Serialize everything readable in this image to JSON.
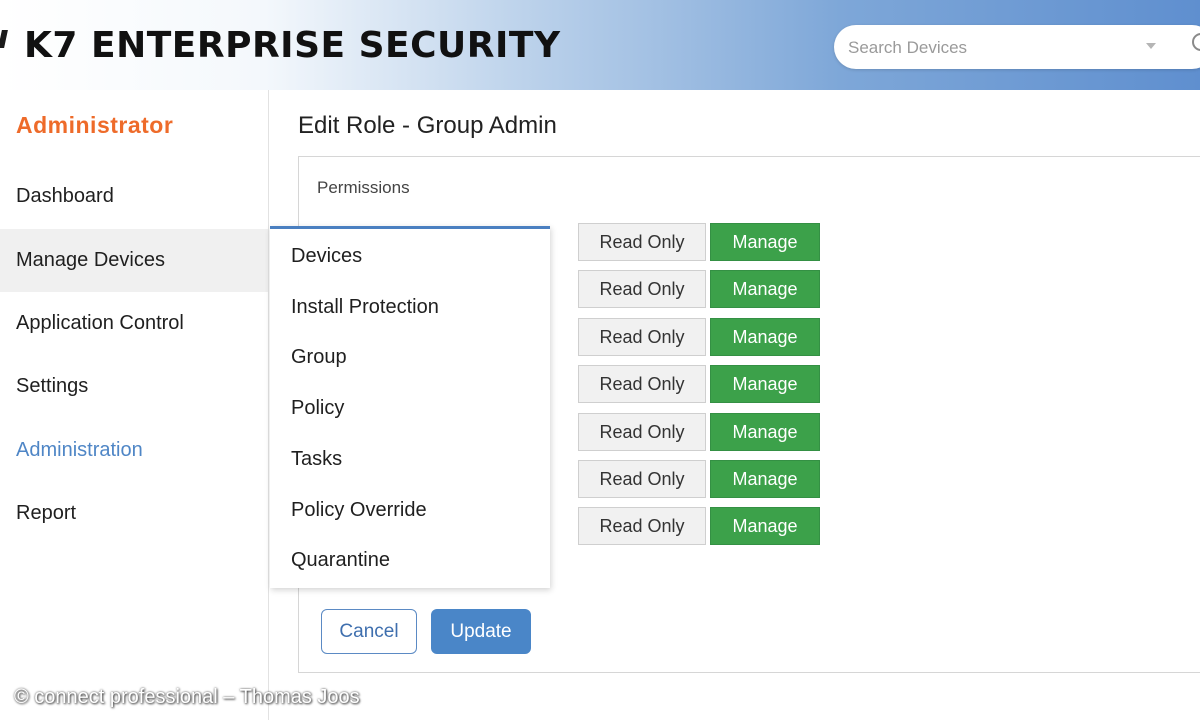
{
  "header": {
    "logo_text": "K7 ENTERPRISE SECURITY",
    "search": {
      "placeholder": "Search Devices",
      "icon": "search-icon",
      "dropdown_icon": "chevron-down-icon"
    },
    "gradient_colors": [
      "#ffffff",
      "#5f8fcf"
    ]
  },
  "sidebar": {
    "title": "Administrator",
    "title_color": "#ee6b2a",
    "items": [
      {
        "label": "Dashboard"
      },
      {
        "label": "Manage Devices",
        "state": "hover"
      },
      {
        "label": "Application Control"
      },
      {
        "label": "Settings"
      },
      {
        "label": "Administration",
        "state": "active"
      },
      {
        "label": "Report"
      }
    ],
    "active_color": "#4f86c6"
  },
  "main": {
    "page_title": "Edit Role - Group Admin",
    "permissions_label": "Permissions",
    "dropdown_items": [
      "Devices",
      "Install Protection",
      "Group",
      "Policy",
      "Tasks",
      "Policy Override",
      "Quarantine"
    ],
    "permission_rows": [
      {
        "read_only_label": "Read Only",
        "manage_label": "Manage",
        "selected": "Manage"
      },
      {
        "read_only_label": "Read Only",
        "manage_label": "Manage",
        "selected": "Manage"
      },
      {
        "read_only_label": "Read Only",
        "manage_label": "Manage",
        "selected": "Manage"
      },
      {
        "read_only_label": "Read Only",
        "manage_label": "Manage",
        "selected": "Manage"
      },
      {
        "read_only_label": "Read Only",
        "manage_label": "Manage",
        "selected": "Manage"
      },
      {
        "read_only_label": "Read Only",
        "manage_label": "Manage",
        "selected": "Manage"
      },
      {
        "read_only_label": "Read Only",
        "manage_label": "Manage",
        "selected": "Manage"
      }
    ],
    "cancel_label": "Cancel",
    "update_label": "Update",
    "manage_color": "#3ca14a",
    "update_color": "#4a86c8"
  },
  "watermark": "© connect professional – Thomas Joos"
}
